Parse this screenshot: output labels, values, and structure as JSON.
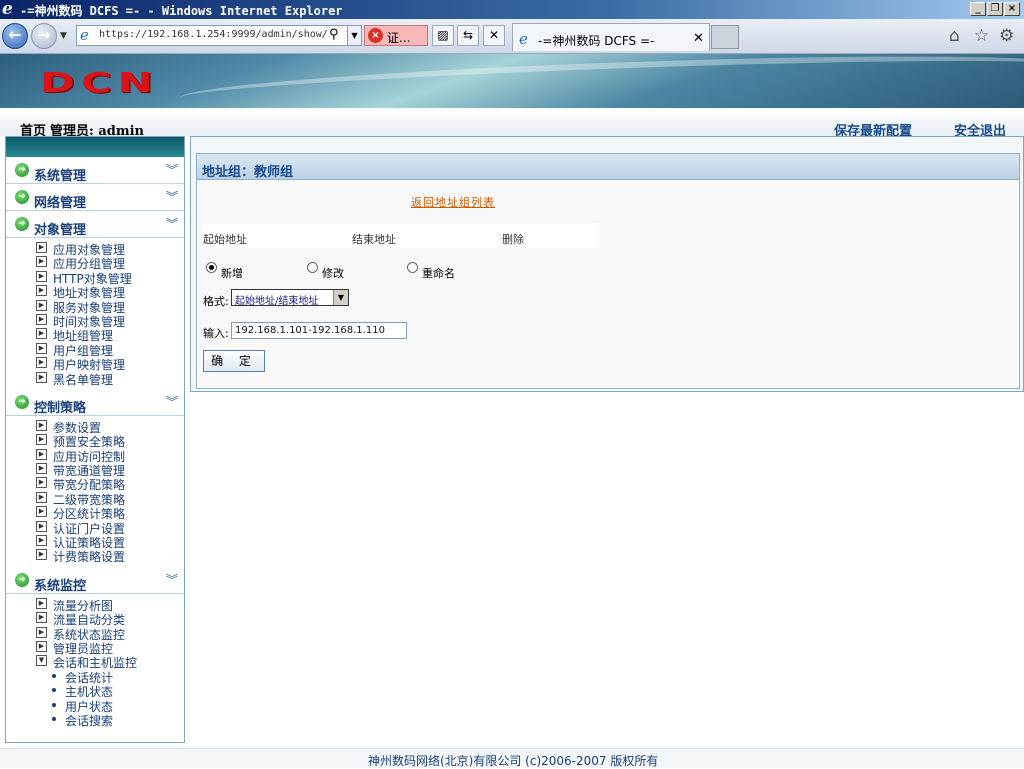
{
  "window": {
    "title": "-=神州数码 DCFS =- - Windows Internet Explorer"
  },
  "browser": {
    "url": "https://192.168.1.254:9999/admin/show/",
    "cert_label": "证...",
    "tab_title": "-=神州数码 DCFS =-"
  },
  "banner": {
    "logo": "DCN"
  },
  "header": {
    "home": "首页",
    "admin": "管理员: admin",
    "save_config": "保存最新配置",
    "logout": "安全退出"
  },
  "sidebar": {
    "sections": [
      {
        "label": "系统管理",
        "items": []
      },
      {
        "label": "网络管理",
        "items": []
      },
      {
        "label": "对象管理",
        "items": [
          "应用对象管理",
          "应用分组管理",
          "HTTP对象管理",
          "地址对象管理",
          "服务对象管理",
          "时间对象管理",
          "地址组管理",
          "用户组管理",
          "用户映射管理",
          "黑名单管理"
        ]
      },
      {
        "label": "控制策略",
        "items": [
          "参数设置",
          "预置安全策略",
          "应用访问控制",
          "带宽通道管理",
          "带宽分配策略",
          "二级带宽策略",
          "分区统计策略",
          "认证门户设置",
          "认证策略设置",
          "计费策略设置"
        ]
      },
      {
        "label": "系统监控",
        "items": [
          "流量分析图",
          "流量自动分类",
          "系统状态监控",
          "管理员监控",
          "会话和主机监控"
        ],
        "subitems": [
          "会话统计",
          "主机状态",
          "用户状态",
          "会话搜索"
        ]
      }
    ]
  },
  "main": {
    "panel_title": "地址组：教师组",
    "back_link": "返回地址组列表",
    "columns": [
      "起始地址",
      "结束地址",
      "删除"
    ],
    "radios": [
      {
        "label": "新增",
        "checked": true
      },
      {
        "label": "修改",
        "checked": false
      },
      {
        "label": "重命名",
        "checked": false
      }
    ],
    "format_label": "格式:",
    "format_value": "起始地址/结束地址",
    "input_label": "输入:",
    "input_value": "192.168.1.101-192.168.1.110",
    "ok_label": "确 定"
  },
  "footer": {
    "text": "神州数码网络(北京)有限公司 (c)2006-2007 版权所有"
  },
  "colors": {
    "accent": "#1a4c8c",
    "logo": "#d8141a",
    "link": "#d05a00"
  }
}
